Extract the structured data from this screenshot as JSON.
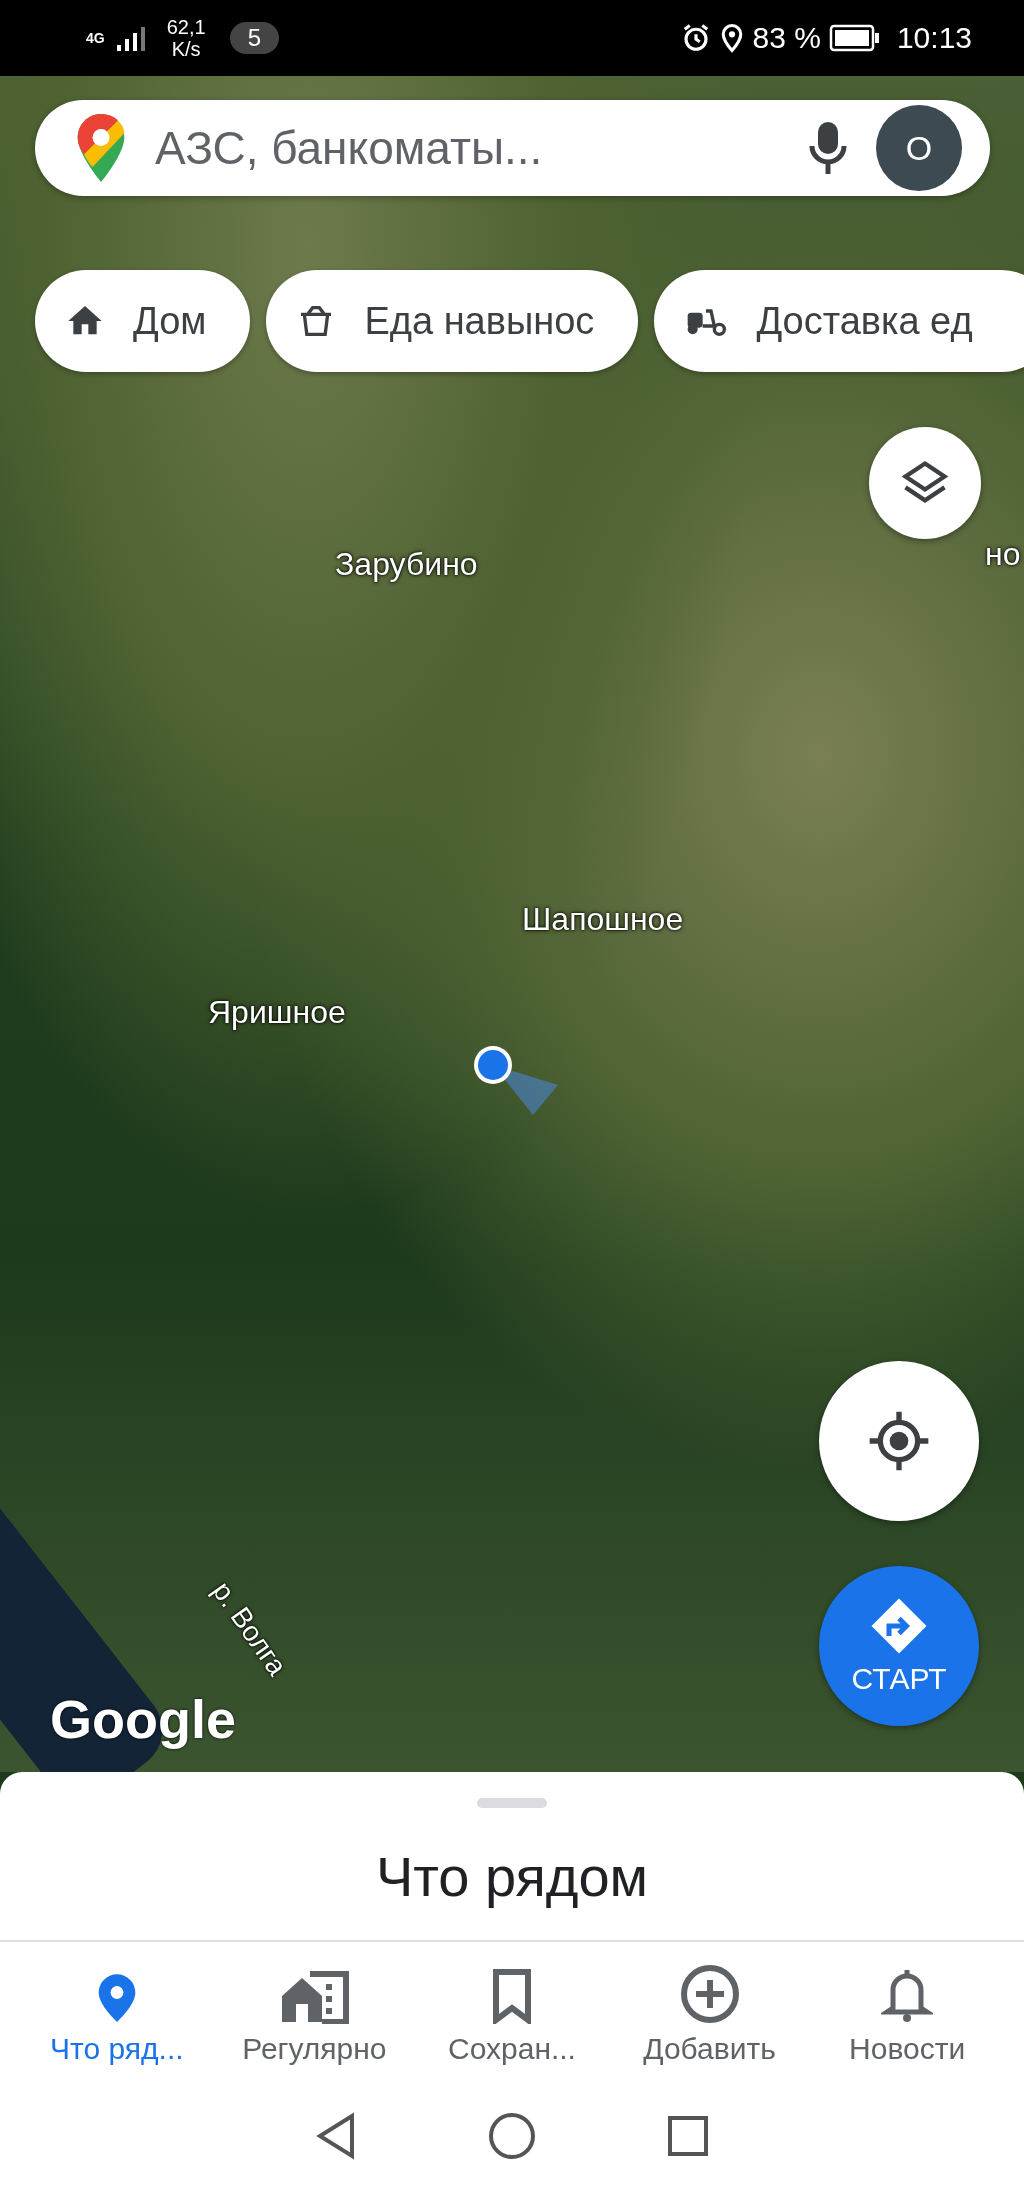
{
  "status_bar": {
    "network": "4G",
    "speed_value": "62,1",
    "speed_unit": "K/s",
    "notification_count": "5",
    "battery": "83 %",
    "time": "10:13"
  },
  "search": {
    "placeholder": "АЗС, банкоматы...",
    "avatar_letter": "O"
  },
  "chips": [
    {
      "kind": "home",
      "label": "Дом"
    },
    {
      "kind": "takeout",
      "label": "Еда навынос"
    },
    {
      "kind": "delivery",
      "label": "Доставка ед"
    }
  ],
  "map_labels": [
    {
      "kind": "place",
      "label": "Зарубино"
    },
    {
      "kind": "edge",
      "label": "но"
    },
    {
      "kind": "place",
      "label": "Шапошное"
    },
    {
      "kind": "place",
      "label": "Яришное"
    },
    {
      "kind": "river",
      "label": "р. Волга"
    }
  ],
  "map_logo": "Google",
  "start_button": {
    "label": "СТАРТ"
  },
  "sheet": {
    "title": "Что рядом"
  },
  "nav": [
    {
      "kind": "explore",
      "label": "Что ряд...",
      "selected": true
    },
    {
      "kind": "commute",
      "label": "Регулярно",
      "selected": false
    },
    {
      "kind": "saved",
      "label": "Сохран...",
      "selected": false
    },
    {
      "kind": "contribute",
      "label": "Добавить",
      "selected": false
    },
    {
      "kind": "updates",
      "label": "Новости",
      "selected": false
    }
  ]
}
